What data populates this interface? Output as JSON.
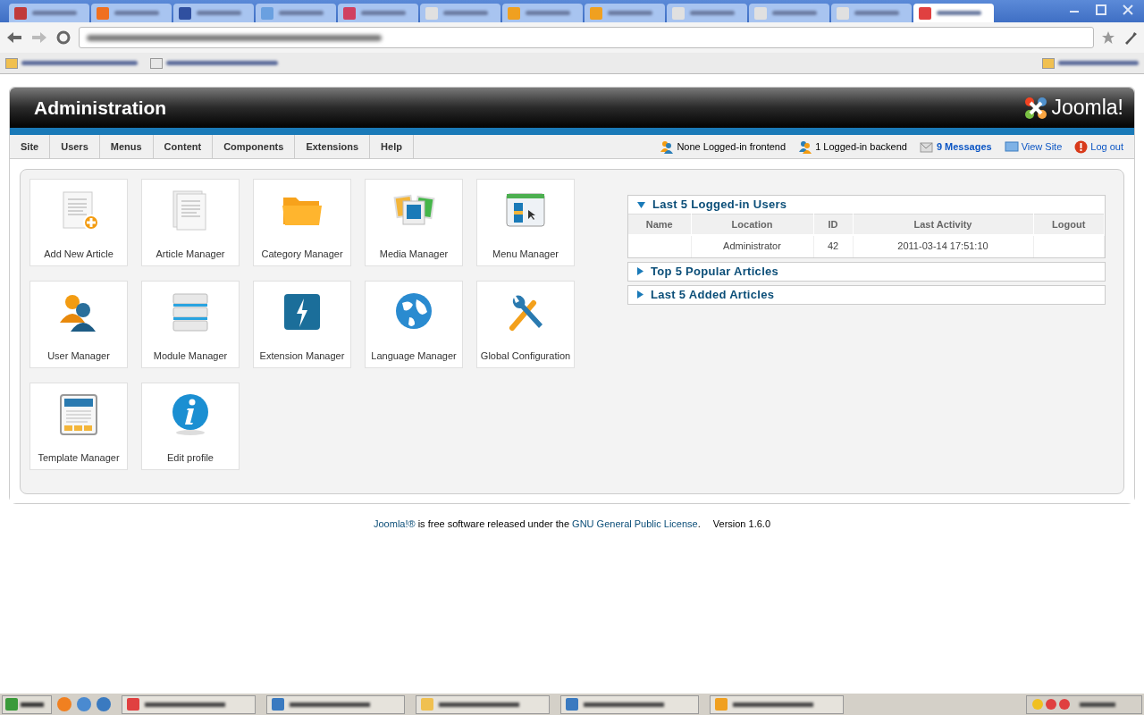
{
  "browser": {
    "tabs": [
      {
        "selected": false
      },
      {
        "selected": false
      },
      {
        "selected": false
      },
      {
        "selected": false
      },
      {
        "selected": false
      },
      {
        "selected": false
      },
      {
        "selected": false
      },
      {
        "selected": false
      },
      {
        "selected": false
      },
      {
        "selected": false
      },
      {
        "selected": false
      },
      {
        "selected": true
      }
    ]
  },
  "header": {
    "title": "Administration",
    "logo": "Joomla!"
  },
  "menu": [
    {
      "label": "Site"
    },
    {
      "label": "Users"
    },
    {
      "label": "Menus"
    },
    {
      "label": "Content"
    },
    {
      "label": "Components"
    },
    {
      "label": "Extensions"
    },
    {
      "label": "Help"
    }
  ],
  "status": [
    {
      "kind": "frontend",
      "text": "None Logged-in frontend"
    },
    {
      "kind": "backend",
      "text": "1 Logged-in backend"
    },
    {
      "kind": "messages",
      "text": "9 Messages"
    },
    {
      "kind": "viewsite",
      "text": "View Site"
    },
    {
      "kind": "logout",
      "text": "Log out"
    }
  ],
  "quickicons": [
    {
      "kind": "add-article",
      "label": "Add New Article"
    },
    {
      "kind": "article",
      "label": "Article Manager"
    },
    {
      "kind": "folder",
      "label": "Category Manager"
    },
    {
      "kind": "media",
      "label": "Media Manager"
    },
    {
      "kind": "menu",
      "label": "Menu Manager"
    },
    {
      "kind": "users",
      "label": "User Manager"
    },
    {
      "kind": "modules",
      "label": "Module Manager"
    },
    {
      "kind": "extension",
      "label": "Extension Manager"
    },
    {
      "kind": "globe",
      "label": "Language Manager"
    },
    {
      "kind": "tools",
      "label": "Global Configuration"
    },
    {
      "kind": "template",
      "label": "Template Manager"
    },
    {
      "kind": "info",
      "label": "Edit profile"
    }
  ],
  "panels": [
    {
      "title": "Last 5 Logged-in Users",
      "expanded": true,
      "table": {
        "columns": [
          "Name",
          "Location",
          "ID",
          "Last Activity",
          "Logout"
        ],
        "rows": [
          {
            "location": "Administrator",
            "id": "42",
            "last_activity": "2011-03-14 17:51:10"
          }
        ]
      }
    },
    {
      "title": "Top 5 Popular Articles",
      "expanded": false
    },
    {
      "title": "Last 5 Added Articles",
      "expanded": false
    }
  ],
  "footer": {
    "link": "Joomla!®",
    "text": " is free software released under the ",
    "license": "GNU General Public License",
    "end": ".",
    "version": "Version 1.6.0"
  }
}
